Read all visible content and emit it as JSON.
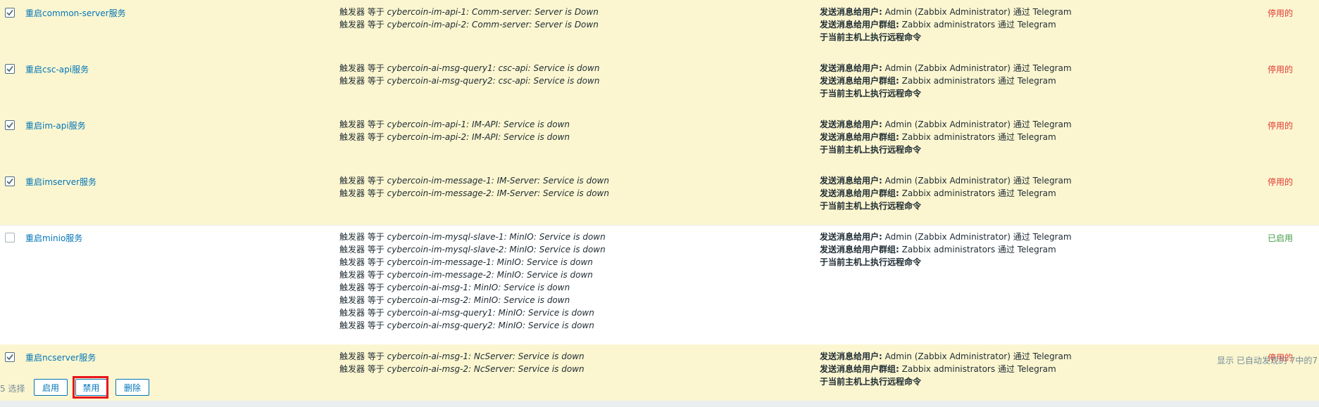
{
  "rows": [
    {
      "name": "重启common-server服务",
      "checked": true,
      "conditions": [
        {
          "label": "触发器 等于",
          "value": "cybercoin-im-api-1: Comm-server: Server is Down"
        },
        {
          "label": "触发器 等于",
          "value": "cybercoin-im-api-2: Comm-server: Server is Down"
        }
      ],
      "status": "停用的",
      "status_kind": "off"
    },
    {
      "name": "重启csc-api服务",
      "checked": true,
      "conditions": [
        {
          "label": "触发器 等于",
          "value": "cybercoin-ai-msg-query1: csc-api: Service is down"
        },
        {
          "label": "触发器 等于",
          "value": "cybercoin-ai-msg-query2: csc-api: Service is down"
        }
      ],
      "status": "停用的",
      "status_kind": "off"
    },
    {
      "name": "重启im-api服务",
      "checked": true,
      "conditions": [
        {
          "label": "触发器 等于",
          "value": "cybercoin-im-api-1: IM-API: Service is down"
        },
        {
          "label": "触发器 等于",
          "value": "cybercoin-im-api-2: IM-API: Service is down"
        }
      ],
      "status": "停用的",
      "status_kind": "off"
    },
    {
      "name": "重启imserver服务",
      "checked": true,
      "conditions": [
        {
          "label": "触发器 等于",
          "value": "cybercoin-im-message-1: IM-Server: Service is down"
        },
        {
          "label": "触发器 等于",
          "value": "cybercoin-im-message-2: IM-Server: Service is down"
        }
      ],
      "status": "停用的",
      "status_kind": "off"
    },
    {
      "name": "重启minio服务",
      "checked": false,
      "conditions": [
        {
          "label": "触发器 等于",
          "value": "cybercoin-im-mysql-slave-1: MinIO: Service is down"
        },
        {
          "label": "触发器 等于",
          "value": "cybercoin-im-mysql-slave-2: MinIO: Service is down"
        },
        {
          "label": "触发器 等于",
          "value": "cybercoin-im-message-1: MinIO: Service is down"
        },
        {
          "label": "触发器 等于",
          "value": "cybercoin-im-message-2: MinIO: Service is down"
        },
        {
          "label": "触发器 等于",
          "value": "cybercoin-ai-msg-1: MinIO: Service is down"
        },
        {
          "label": "触发器 等于",
          "value": "cybercoin-ai-msg-2: MinIO: Service is down"
        },
        {
          "label": "触发器 等于",
          "value": "cybercoin-ai-msg-query1: MinIO: Service is down"
        },
        {
          "label": "触发器 等于",
          "value": "cybercoin-ai-msg-query2: MinIO: Service is down"
        }
      ],
      "status": "已启用",
      "status_kind": "on"
    },
    {
      "name": "重启ncserver服务",
      "checked": true,
      "conditions": [
        {
          "label": "触发器 等于",
          "value": "cybercoin-ai-msg-1: NcServer: Service is down"
        },
        {
          "label": "触发器 等于",
          "value": "cybercoin-ai-msg-2: NcServer: Service is down"
        }
      ],
      "status": "停用的",
      "status_kind": "off"
    }
  ],
  "operations": {
    "user_label": "发送消息给用户:",
    "user_value": "Admin (Zabbix Administrator) 通过 Telegram",
    "group_label": "发送消息给用户群组:",
    "group_value": "Zabbix administrators 通过 Telegram",
    "remote_cmd": "于当前主机上执行远程命令"
  },
  "footer_info": "显示 已自动发现的 7中的7",
  "selected_count": "5 选择",
  "buttons": {
    "enable": "启用",
    "disable": "禁用",
    "delete": "删除"
  },
  "colors": {
    "link": "#0275b8",
    "status_off": "#e33734",
    "status_on": "#429e47",
    "selected_row": "#fbf6d0",
    "highlight": "#e8141c"
  }
}
